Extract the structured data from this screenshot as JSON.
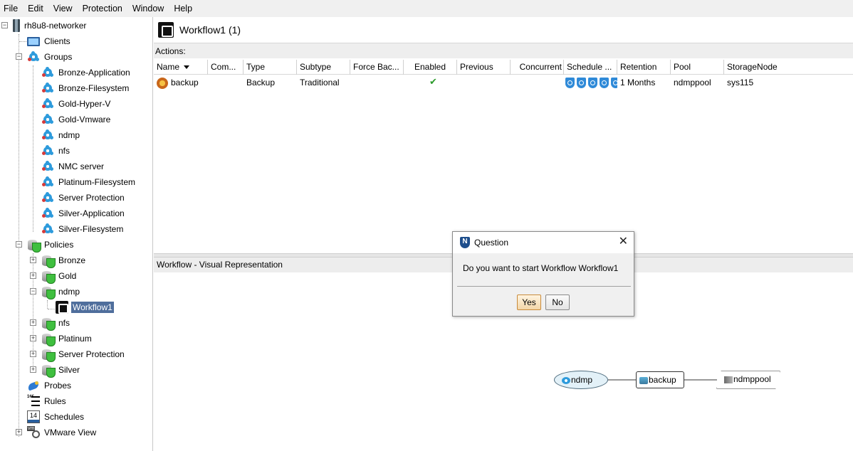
{
  "menubar": {
    "items": [
      "File",
      "Edit",
      "View",
      "Protection",
      "Window",
      "Help"
    ]
  },
  "tree": {
    "root": "rh8u8-networker",
    "clients": "Clients",
    "groups_label": "Groups",
    "groups": [
      "Bronze-Application",
      "Bronze-Filesystem",
      "Gold-Hyper-V",
      "Gold-Vmware",
      "ndmp",
      "nfs",
      "NMC server",
      "Platinum-Filesystem",
      "Server Protection",
      "Silver-Application",
      "Silver-Filesystem"
    ],
    "policies_label": "Policies",
    "policies": [
      "Bronze",
      "Gold",
      "ndmp",
      "nfs",
      "Platinum",
      "Server Protection",
      "Silver"
    ],
    "selected_workflow": "Workflow1",
    "probes": "Probes",
    "rules": "Rules",
    "schedules": "Schedules",
    "schedules_icon_text": "14",
    "vmware": "VMware View"
  },
  "header": {
    "title": "Workflow1 (1)"
  },
  "actions": {
    "label": "Actions:",
    "columns": [
      "Name",
      "Com...",
      "Type",
      "Subtype",
      "Force Bac...",
      "Enabled",
      "Previous",
      "Concurrent",
      "Schedule ...",
      "Retention",
      "Pool",
      "StorageNode"
    ],
    "rows": [
      {
        "name": "backup",
        "comment": "",
        "type": "Backup",
        "subtype": "Traditional",
        "force": "",
        "enabled": "✔",
        "previous": "",
        "concurrent": "",
        "retention": "1 Months",
        "pool": "ndmppool",
        "storage_node": "sys115"
      }
    ]
  },
  "visual": {
    "label": "Workflow - Visual Representation",
    "nodes": {
      "group": "ndmp",
      "action": "backup",
      "pool": "ndmppool"
    }
  },
  "dialog": {
    "title": "Question",
    "icon_letter": "N",
    "close": "✕",
    "message": "Do you want to start Workflow Workflow1",
    "yes": "Yes",
    "no": "No"
  },
  "colors": {
    "selection": "#4f6e9c",
    "accent_blue": "#2e9bdc",
    "check_green": "#2a9a2a"
  }
}
